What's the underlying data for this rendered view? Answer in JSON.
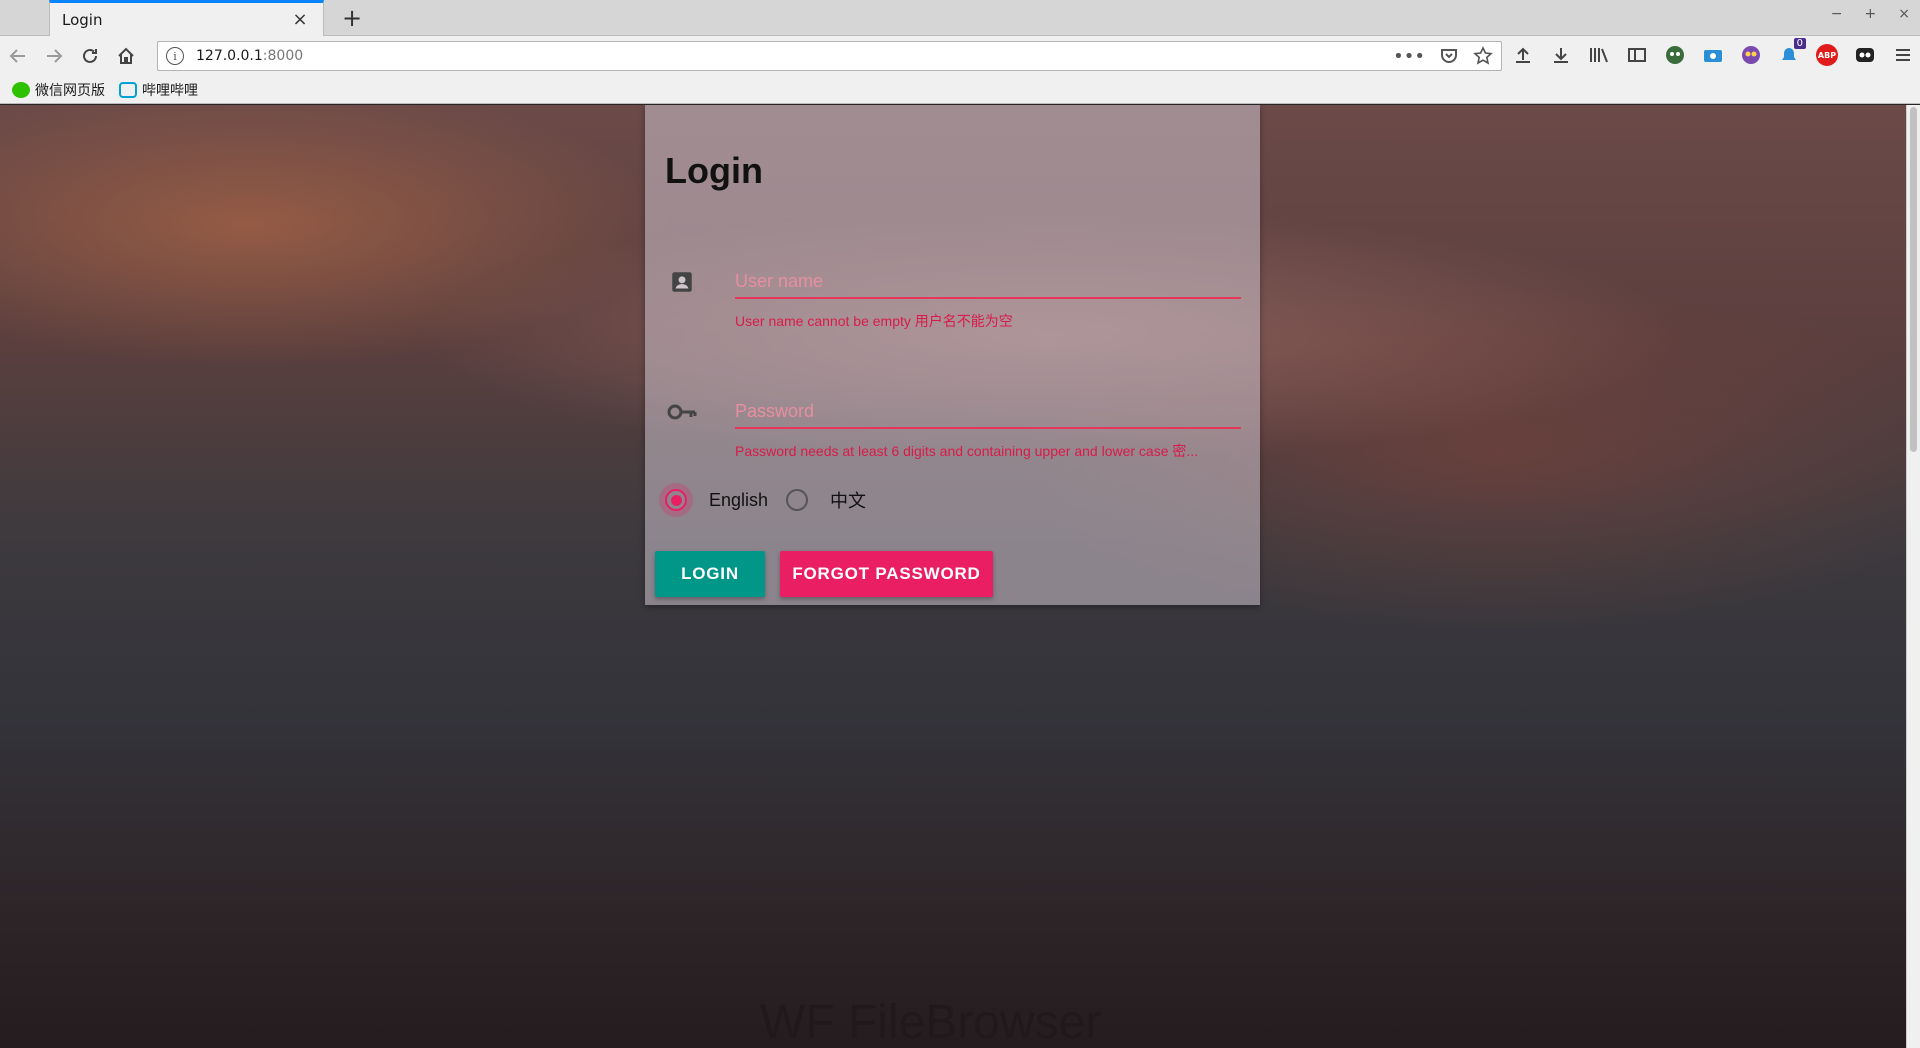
{
  "browser": {
    "tab_title": "Login",
    "tab_close": "×",
    "new_tab": "+",
    "window_controls": [
      "−",
      "+",
      "×"
    ],
    "url_host": "127.0.0.1",
    "url_port": ":8000",
    "url_info": "i",
    "toolbar_badge": "0",
    "abp_label": "ABP"
  },
  "bookmarks": [
    {
      "label": "微信网页版",
      "icon": "wechat-icon"
    },
    {
      "label": "哔哩哔哩",
      "icon": "bilibili-icon"
    }
  ],
  "login": {
    "title": "Login",
    "username_placeholder": "User name",
    "username_error": "User name cannot be empty 用户名不能为空",
    "password_placeholder": "Password",
    "password_error": "Password needs at least 6 digits and containing upper and lower case 密...",
    "lang_options": [
      "English",
      "中文"
    ],
    "lang_selected": "English",
    "login_button": "LOGIN",
    "forgot_button": "FORGOT PASSWORD",
    "footer_brand": "WF FileBrowser"
  },
  "colors": {
    "accent_pink": "#e91e63",
    "teal": "#009688",
    "error_red": "#d81b4a"
  }
}
